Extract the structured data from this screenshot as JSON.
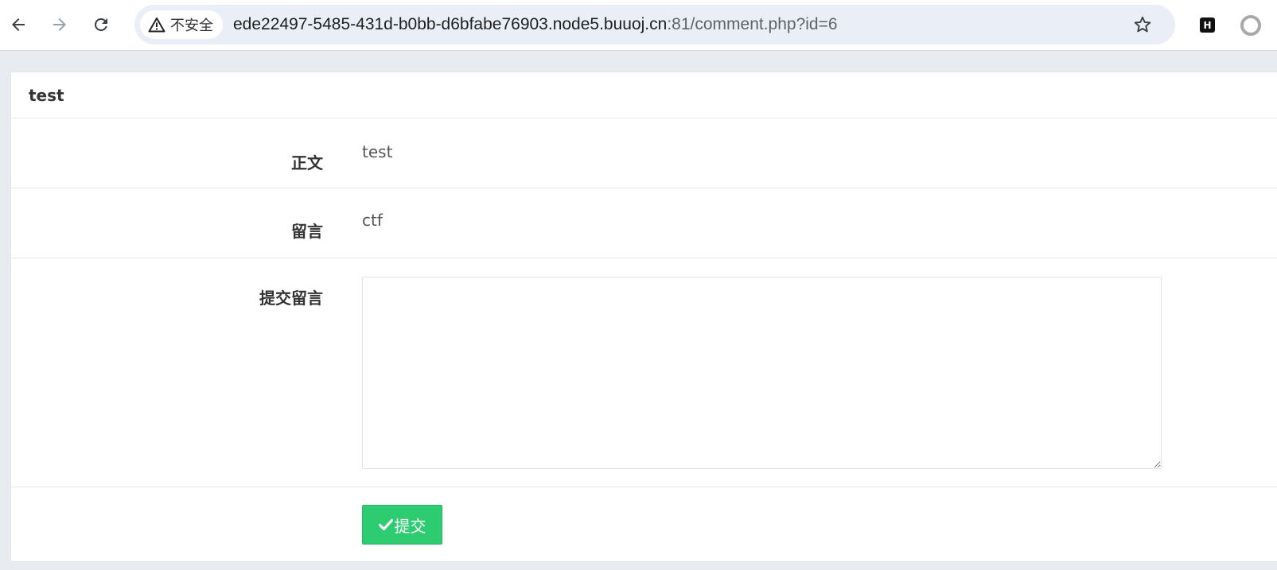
{
  "browser": {
    "back_icon": "arrow-left-icon",
    "forward_icon": "arrow-right-icon",
    "reload_icon": "reload-icon",
    "security_label": "不安全",
    "url_host": "ede22497-5485-431d-b0bb-d6bfabe76903.node5.buuoj.cn",
    "url_path": ":81/comment.php?id=6",
    "bookmark_icon": "star-icon",
    "extension_label": "H",
    "profile_icon": "profile-circle-icon"
  },
  "post": {
    "title": "test",
    "body_label": "正文",
    "body_value": "test",
    "comment_label": "留言",
    "comment_value": "ctf",
    "submit_comment_label": "提交留言",
    "textarea_value": "",
    "submit_button_label": "提交",
    "submit_icon": "check-icon"
  },
  "colors": {
    "submit_button": "#2ecc71",
    "page_background": "#e8ebef",
    "omnibox_background": "#eaeef6"
  }
}
